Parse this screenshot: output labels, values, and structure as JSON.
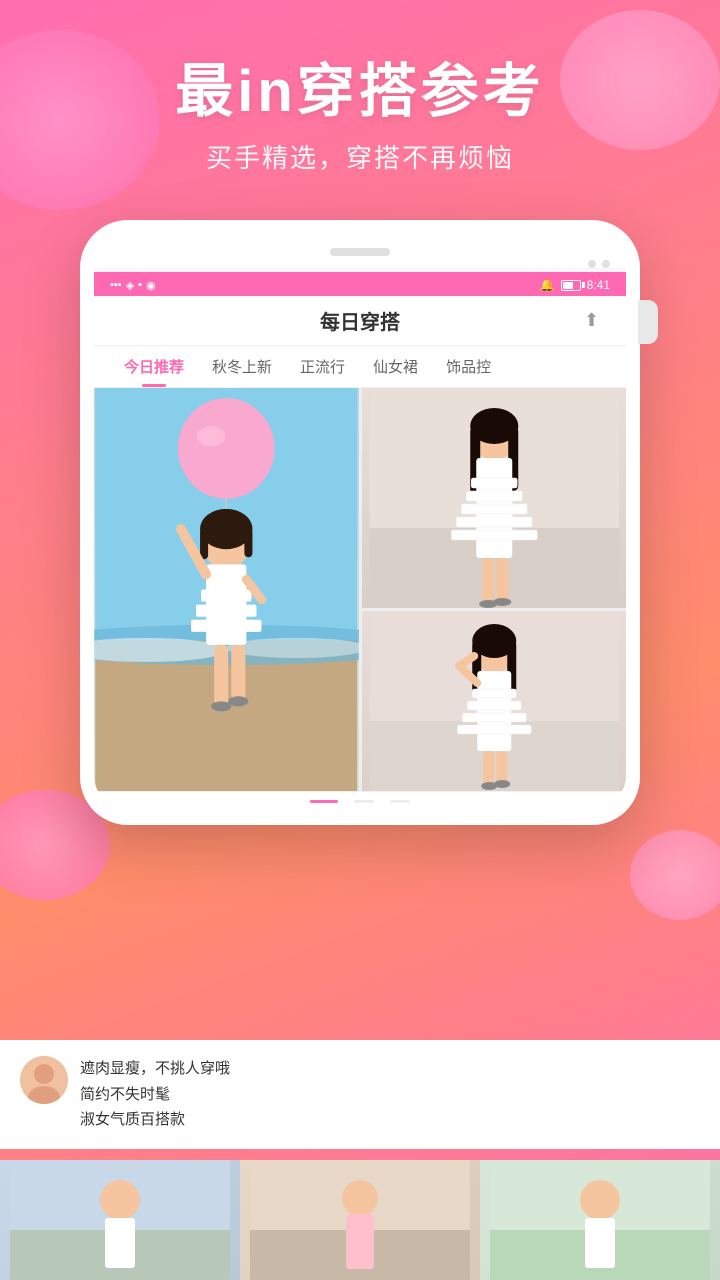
{
  "background": {
    "gradient_start": "#ff6eb0",
    "gradient_end": "#ff8c6b"
  },
  "hero": {
    "title": "最in穿搭参考",
    "subtitle": "买手精选，穿搭不再烦恼"
  },
  "phone": {
    "status_bar": {
      "time": "8:41",
      "icons_left": "📶",
      "bell_icon": "🔔"
    },
    "app_title": "每日穿搭",
    "share_icon": "⬆",
    "tabs": [
      {
        "label": "今日推荐",
        "active": true
      },
      {
        "label": "秋冬上新",
        "active": false
      },
      {
        "label": "正流行",
        "active": false
      },
      {
        "label": "仙女裙",
        "active": false
      },
      {
        "label": "饰品控",
        "active": false
      }
    ]
  },
  "comments": {
    "lines": [
      "遮肉显瘦，不挑人穿哦",
      "简约不失时髦",
      "淑女气质百搭款"
    ]
  },
  "bottom_thumbnails": [
    {
      "alt": "fashion1"
    },
    {
      "alt": "fashion2"
    },
    {
      "alt": "fashion3"
    }
  ]
}
